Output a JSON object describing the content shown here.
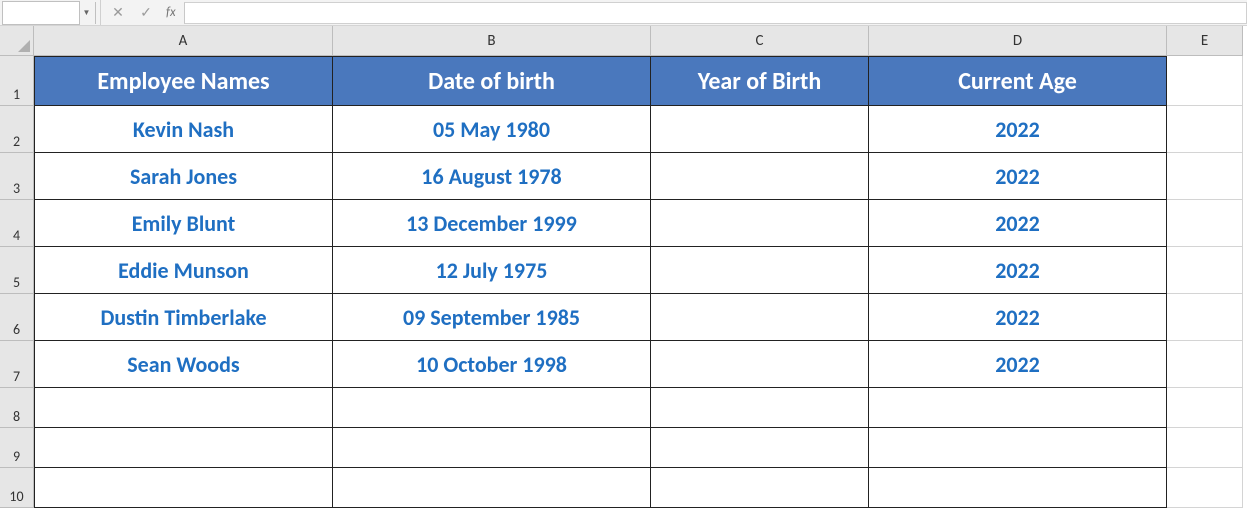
{
  "formula_bar": {
    "name_box": "",
    "fx": "fx",
    "cancel": "✕",
    "enter": "✓",
    "formula": ""
  },
  "columns": [
    "A",
    "B",
    "C",
    "D",
    "E"
  ],
  "row_numbers": [
    "1",
    "2",
    "3",
    "4",
    "5",
    "6",
    "7",
    "8",
    "9",
    "10"
  ],
  "headers": {
    "A": "Employee Names",
    "B": "Date of birth",
    "C": "Year of Birth",
    "D": "Current Age"
  },
  "rows": [
    {
      "name": "Kevin Nash",
      "dob": "05 May 1980",
      "yob": "",
      "age": "2022"
    },
    {
      "name": "Sarah Jones",
      "dob": "16 August 1978",
      "yob": "",
      "age": "2022"
    },
    {
      "name": "Emily Blunt",
      "dob": "13 December 1999",
      "yob": "",
      "age": "2022"
    },
    {
      "name": "Eddie Munson",
      "dob": "12 July 1975",
      "yob": "",
      "age": "2022"
    },
    {
      "name": "Dustin Timberlake",
      "dob": "09 September 1985",
      "yob": "",
      "age": "2022"
    },
    {
      "name": "Sean Woods",
      "dob": "10 October 1998",
      "yob": "",
      "age": "2022"
    }
  ]
}
